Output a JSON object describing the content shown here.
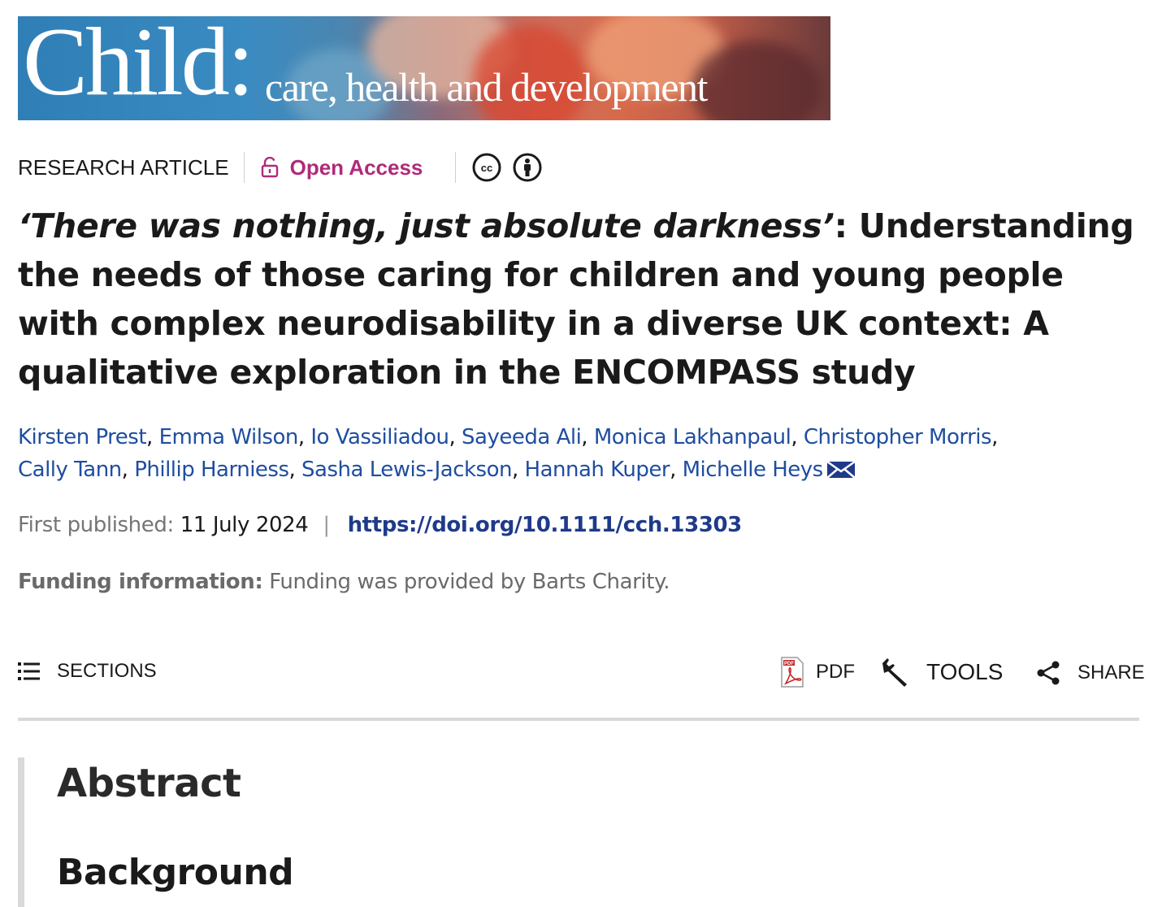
{
  "journal": {
    "banner_title": "Child:",
    "banner_subtitle": "care, health and development"
  },
  "article": {
    "type": "RESEARCH ARTICLE",
    "access_label": "Open Access",
    "license_icons": [
      "cc-icon",
      "by-attribution-icon"
    ],
    "title_italic": "‘There was nothing, just absolute darkness’",
    "title_rest": ": Understanding the needs of those caring for children and young people with complex neurodisability in a diverse UK context: A qualitative exploration in the ENCOMPASS study",
    "authors": [
      "Kirsten Prest",
      "Emma Wilson",
      "Io Vassiliadou",
      "Sayeeda Ali",
      "Monica Lakhanpaul",
      "Christopher Morris",
      "Cally Tann",
      "Phillip Harniess",
      "Sasha Lewis-Jackson",
      "Hannah Kuper",
      "Michelle Heys"
    ],
    "first_published_label": "First published:",
    "first_published_date": "11 July 2024",
    "separator": "|",
    "doi": "https://doi.org/10.1111/cch.13303",
    "funding_label": "Funding information:",
    "funding_text": "Funding was provided by Barts Charity."
  },
  "toolbar": {
    "sections_label": "SECTIONS",
    "pdf_label": "PDF",
    "tools_label": "TOOLS",
    "share_label": "SHARE"
  },
  "abstract": {
    "heading": "Abstract",
    "subheading": "Background"
  },
  "colors": {
    "open_access": "#b02a79",
    "link": "#1f4ea0",
    "doi": "#1f3a8a"
  }
}
